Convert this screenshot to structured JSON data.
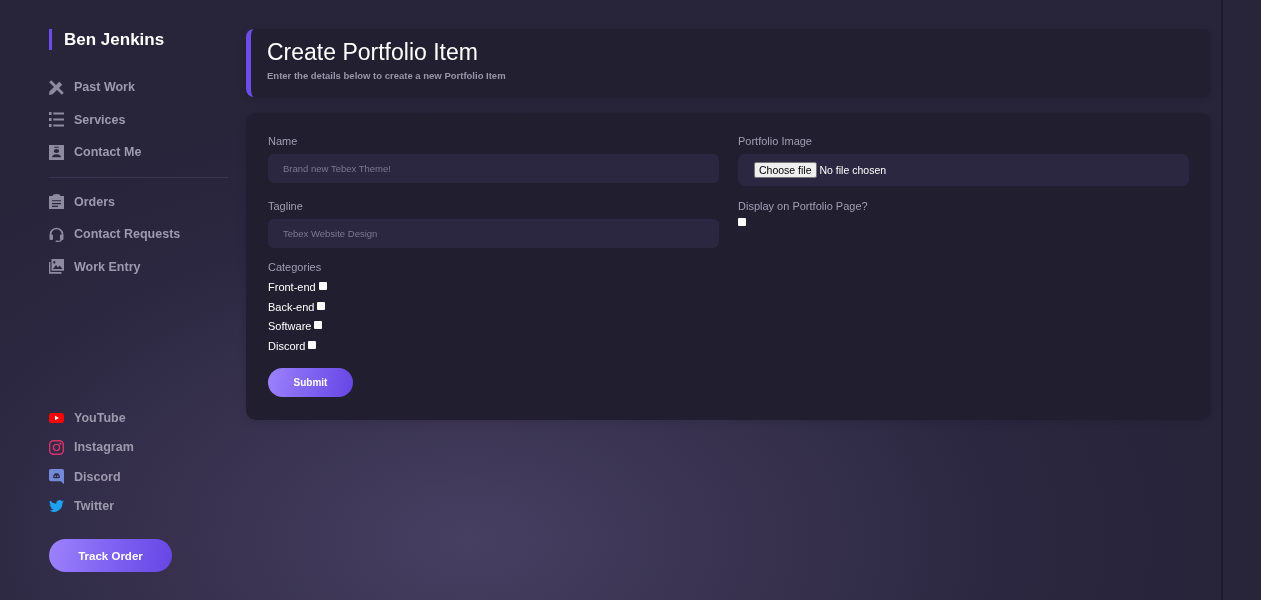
{
  "sidebar": {
    "brand": "Ben Jenkins",
    "nav": [
      {
        "label": "Past Work",
        "selected": false
      },
      {
        "label": "Services",
        "selected": false
      },
      {
        "label": "Contact Me",
        "selected": false
      }
    ],
    "nav_admin": [
      {
        "label": "Orders",
        "selected": false
      },
      {
        "label": "Contact Requests",
        "selected": false
      },
      {
        "label": "Work Entry",
        "selected": false
      }
    ],
    "social_links": [
      {
        "label": "YouTube"
      },
      {
        "label": "Instagram"
      },
      {
        "label": "Discord"
      },
      {
        "label": "Twitter"
      }
    ],
    "track_order_button": "Track Order"
  },
  "header": {
    "title": "Create Portfolio Item",
    "subtitle": "Enter the details below to create a new Portfolio Item"
  },
  "form": {
    "name": {
      "label": "Name",
      "placeholder": "Brand new Tebex Theme!"
    },
    "tagline": {
      "label": "Tagline",
      "placeholder": "Tebex Website Design"
    },
    "categories": {
      "label": "Categories",
      "options": [
        {
          "label": "Front-end",
          "checked": false
        },
        {
          "label": "Back-end",
          "checked": false
        },
        {
          "label": "Software",
          "checked": false
        },
        {
          "label": "Discord",
          "checked": false
        }
      ]
    },
    "submit_button": "Submit",
    "portfolio_image": {
      "label": "Portfolio Image",
      "button": "Choose file",
      "status": "No file chosen"
    },
    "display_on_portfolio": {
      "label": "Display on Portfolio Page?",
      "checked": false
    }
  }
}
